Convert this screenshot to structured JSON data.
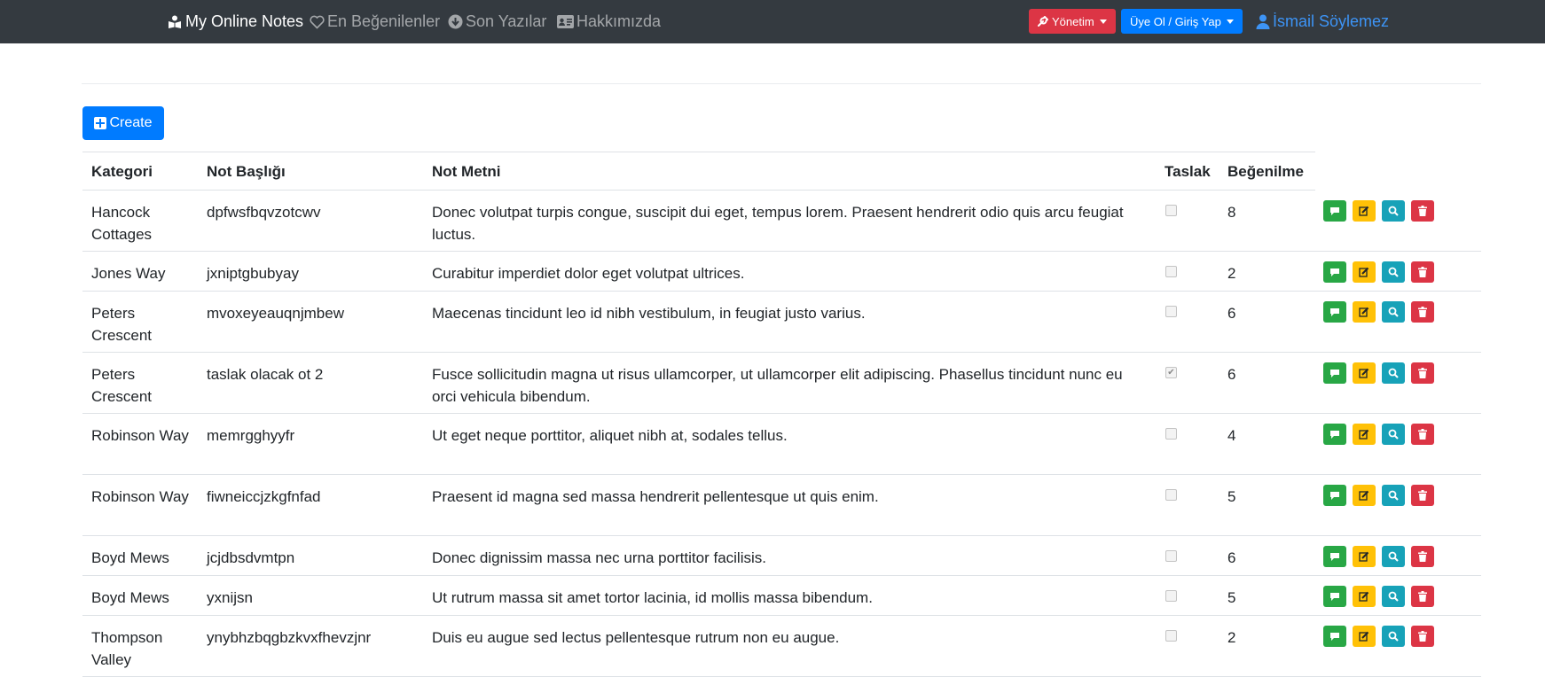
{
  "navbar": {
    "brand": "My Online Notes",
    "links": [
      "En Beğenilenler",
      "Son Yazılar",
      "Hakkımızda"
    ],
    "admin_button": "Yönetim",
    "auth_button": "Üye Ol / Giriş Yap",
    "user_name": "İsmail Söylemez"
  },
  "toolbar": {
    "create_label": "Create"
  },
  "table": {
    "headers": {
      "category": "Kategori",
      "title": "Not Başlığı",
      "text": "Not Metni",
      "draft": "Taslak",
      "likes": "Beğenilme"
    },
    "rows": [
      {
        "category": "Hancock Cottages",
        "title": "dpfwsfbqvzotcwv",
        "text": "Donec volutpat turpis congue, suscipit dui eget, tempus lorem. Praesent hendrerit odio quis arcu feugiat luctus.",
        "draft": false,
        "likes": "8"
      },
      {
        "category": "Jones Way",
        "title": "jxniptgbubyay",
        "text": "Curabitur imperdiet dolor eget volutpat ultrices.",
        "draft": false,
        "likes": "2"
      },
      {
        "category": "Peters Crescent",
        "title": "mvoxeyeauqnjmbew",
        "text": "Maecenas tincidunt leo id nibh vestibulum, in feugiat justo varius.",
        "draft": false,
        "likes": "6"
      },
      {
        "category": "Peters Crescent",
        "title": "taslak olacak ot 2",
        "text": "Fusce sollicitudin magna ut risus ullamcorper, ut ullamcorper elit adipiscing. Phasellus tincidunt nunc eu orci vehicula bibendum.",
        "draft": true,
        "likes": "6"
      },
      {
        "category": "Robinson Way",
        "title": "memrgghyyfr",
        "text": "Ut eget neque porttitor, aliquet nibh at, sodales tellus.",
        "draft": false,
        "likes": "4"
      },
      {
        "category": "Robinson Way",
        "title": "fiwneiccjzkgfnfad",
        "text": "Praesent id magna sed massa hendrerit pellentesque ut quis enim.",
        "draft": false,
        "likes": "5"
      },
      {
        "category": "Boyd Mews",
        "title": "jcjdbsdvmtpn",
        "text": "Donec dignissim massa nec urna porttitor facilisis.",
        "draft": false,
        "likes": "6"
      },
      {
        "category": "Boyd Mews",
        "title": "yxnijsn",
        "text": "Ut rutrum massa sit amet tortor lacinia, id mollis massa bibendum.",
        "draft": false,
        "likes": "5"
      },
      {
        "category": "Thompson Valley",
        "title": "ynybhzbqgbzkvxfhevzjnr",
        "text": "Duis eu augue sed lectus pellentesque rutrum non eu augue.",
        "draft": false,
        "likes": "2"
      }
    ]
  },
  "colors": {
    "navbar": "#343a40",
    "primary": "#007bff",
    "danger": "#dc3545",
    "success": "#28a745",
    "warning": "#ffc107",
    "info": "#17a2b8"
  },
  "icons": {
    "brand": "book-reader-icon",
    "links": [
      "heart-icon",
      "arrow-circle-down-icon",
      "id-card-icon"
    ],
    "admin": "wrench-icon",
    "user": "user-icon",
    "actions": [
      "comment-icon",
      "edit-icon",
      "search-icon",
      "trash-icon"
    ]
  }
}
